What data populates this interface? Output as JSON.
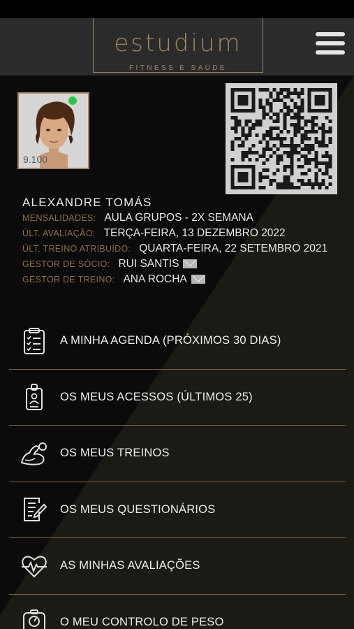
{
  "header": {
    "logo_text": "estudium",
    "logo_subtitle": "FITNESS E SAÚDE",
    "menu_icon": "hamburger-icon"
  },
  "profile": {
    "avatar_id": "9.100",
    "online_status_color": "#2ec24a",
    "name": "ALEXANDRE TOMÁS",
    "fields": [
      {
        "label": "MENSALIDADES:",
        "value": "AULA GRUPOS - 2X SEMANA"
      },
      {
        "label": "ÚLT. AVALIAÇÃO:",
        "value": "TERÇA-FEIRA, 13 DEZEMBRO 2022"
      },
      {
        "label": "ÚLT. TREINO ATRIBUÍDO:",
        "value": "QUARTA-FEIRA, 22 SETEMBRO 2021"
      },
      {
        "label": "GESTOR DE SÓCIO:",
        "value": "RUI SANTIS",
        "icon": "envelope-icon"
      },
      {
        "label": "GESTOR DE TREINO:",
        "value": "ANA ROCHA",
        "icon": "envelope-icon"
      }
    ]
  },
  "menu": {
    "items": [
      {
        "label": "A MINHA AGENDA (PRÓXIMOS 30 DIAS)",
        "icon": "clipboard-checklist-icon"
      },
      {
        "label": "OS MEUS ACESSOS (ÚLTIMOS 25)",
        "icon": "id-badge-icon"
      },
      {
        "label": "OS MEUS TREINOS",
        "icon": "flexed-arm-icon"
      },
      {
        "label": "OS MEUS QUESTIONÁRIOS",
        "icon": "form-edit-icon"
      },
      {
        "label": "AS MINHAS AVALIAÇÕES",
        "icon": "heart-pulse-icon"
      },
      {
        "label": "O MEU CONTROLO DE PESO",
        "icon": "scale-icon"
      }
    ]
  },
  "colors": {
    "accent_gold": "#a38763",
    "label_gold": "#8a6e48",
    "background": "#0b0b0b",
    "header_bg": "#2b2b2b",
    "diagonal_panel": "#1b1a14"
  }
}
